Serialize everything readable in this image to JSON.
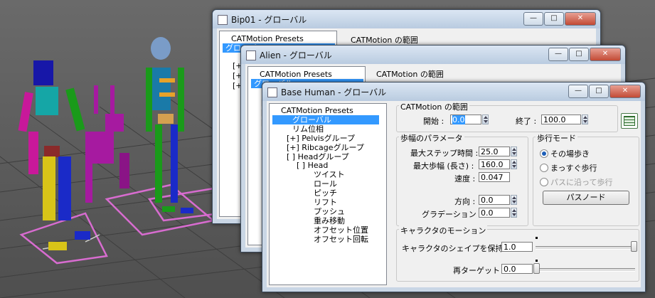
{
  "windows": {
    "back": {
      "title": "Bip01 - グローバル",
      "tree": [
        "CATMotion Presets",
        "グローバル",
        "[+",
        "[+",
        "[+"
      ],
      "range_label": "CATMotion の範囲"
    },
    "mid": {
      "title": "Alien - グローバル",
      "tree": [
        "CATMotion Presets",
        "グローバル",
        "[",
        "[",
        "["
      ],
      "range_label": "CATMotion の範囲"
    },
    "front": {
      "title": "Base Human - グローバル",
      "tree": [
        {
          "label": "CATMotion Presets",
          "indent": 0
        },
        {
          "label": "グローバル",
          "indent": 1,
          "selected": true
        },
        {
          "label": "リム位相",
          "indent": 1
        },
        {
          "label": "[+] Pelvisグループ",
          "indent": 1
        },
        {
          "label": "[+] Ribcageグループ",
          "indent": 1
        },
        {
          "label": "[ ] Headグループ",
          "indent": 1
        },
        {
          "label": "[ ] Head",
          "indent": 2
        },
        {
          "label": "ツイスト",
          "indent": 3
        },
        {
          "label": "ロール",
          "indent": 3
        },
        {
          "label": "ピッチ",
          "indent": 3
        },
        {
          "label": "リフト",
          "indent": 3
        },
        {
          "label": "プッシュ",
          "indent": 3
        },
        {
          "label": "重み移動",
          "indent": 3
        },
        {
          "label": "オフセット位置",
          "indent": 3
        },
        {
          "label": "オフセット回転",
          "indent": 3
        }
      ],
      "range": {
        "label": "CATMotion の範囲",
        "start_label": "開始 :",
        "start": "0.0",
        "end_label": "終了 :",
        "end": "100.0"
      },
      "stride": {
        "label": "歩幅のパラメータ",
        "max_step_time_label": "最大ステップ時間 :",
        "max_step_time": "25.0",
        "max_stride_label": "最大歩幅 (長さ) :",
        "max_stride": "160.0",
        "speed_label": "速度 :",
        "speed": "0.047",
        "direction_label": "方向 :",
        "direction": "0.0",
        "gradient_label": "グラデーション :",
        "gradient": "0.0"
      },
      "walk_mode": {
        "label": "歩行モード",
        "options": [
          "その場歩き",
          "まっすぐ歩行",
          "パスに沿って歩行"
        ],
        "selected": 0,
        "path_node_button": "パスノード"
      },
      "character_motion": {
        "label": "キャラクタのモーション",
        "keep_shape_label": "キャラクタのシェイプを保持 :",
        "keep_shape": "1.0",
        "retarget_label": "再ターゲット :",
        "retarget": "0.0"
      }
    }
  },
  "controls": {
    "minimize": "—",
    "maximize": "□",
    "close": "✕"
  },
  "colors": {
    "selection": "#3399ff",
    "titlebar": "#c9d6e5",
    "viewport": "#5e5e5e"
  }
}
